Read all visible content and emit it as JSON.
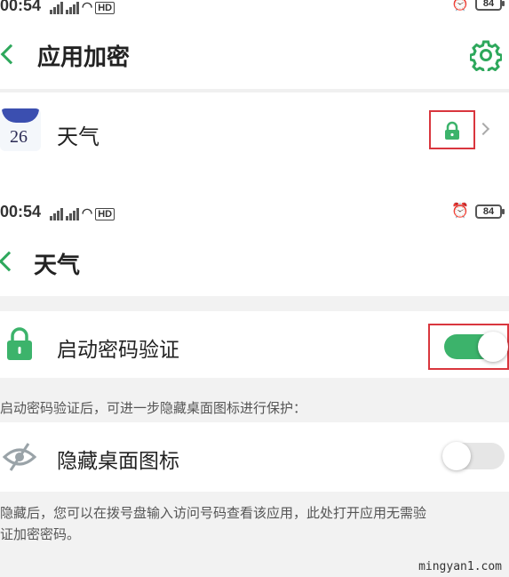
{
  "status_bar_top": {
    "time": "00:54",
    "network": "HD",
    "battery": "84"
  },
  "screen_encryption": {
    "title": "应用加密",
    "app": {
      "name": "天气",
      "icon_number": "26"
    }
  },
  "status_bar_second": {
    "time": "00:54",
    "network": "HD",
    "battery": "84"
  },
  "screen_weather": {
    "title": "天气",
    "password_row": {
      "label": "启动密码验证",
      "enabled": true
    },
    "password_hint": "启动密码验证后，可进一步隐藏桌面图标进行保护：",
    "hide_icon_row": {
      "label": "隐藏桌面图标",
      "enabled": false
    },
    "hide_hint_line1": "隐藏后，您可以在拨号盘输入访问号码查看该应用，此处打开应用无需验",
    "hide_hint_line2": "证加密密码。"
  },
  "watermark": "mingyan1.com",
  "colors": {
    "accent": "#3cb36b",
    "highlight_box": "#d9363e"
  },
  "icons": [
    "back-arrow-icon",
    "gear-icon",
    "lock-icon",
    "chevron-right-icon",
    "eye-off-icon",
    "alarm-icon"
  ]
}
